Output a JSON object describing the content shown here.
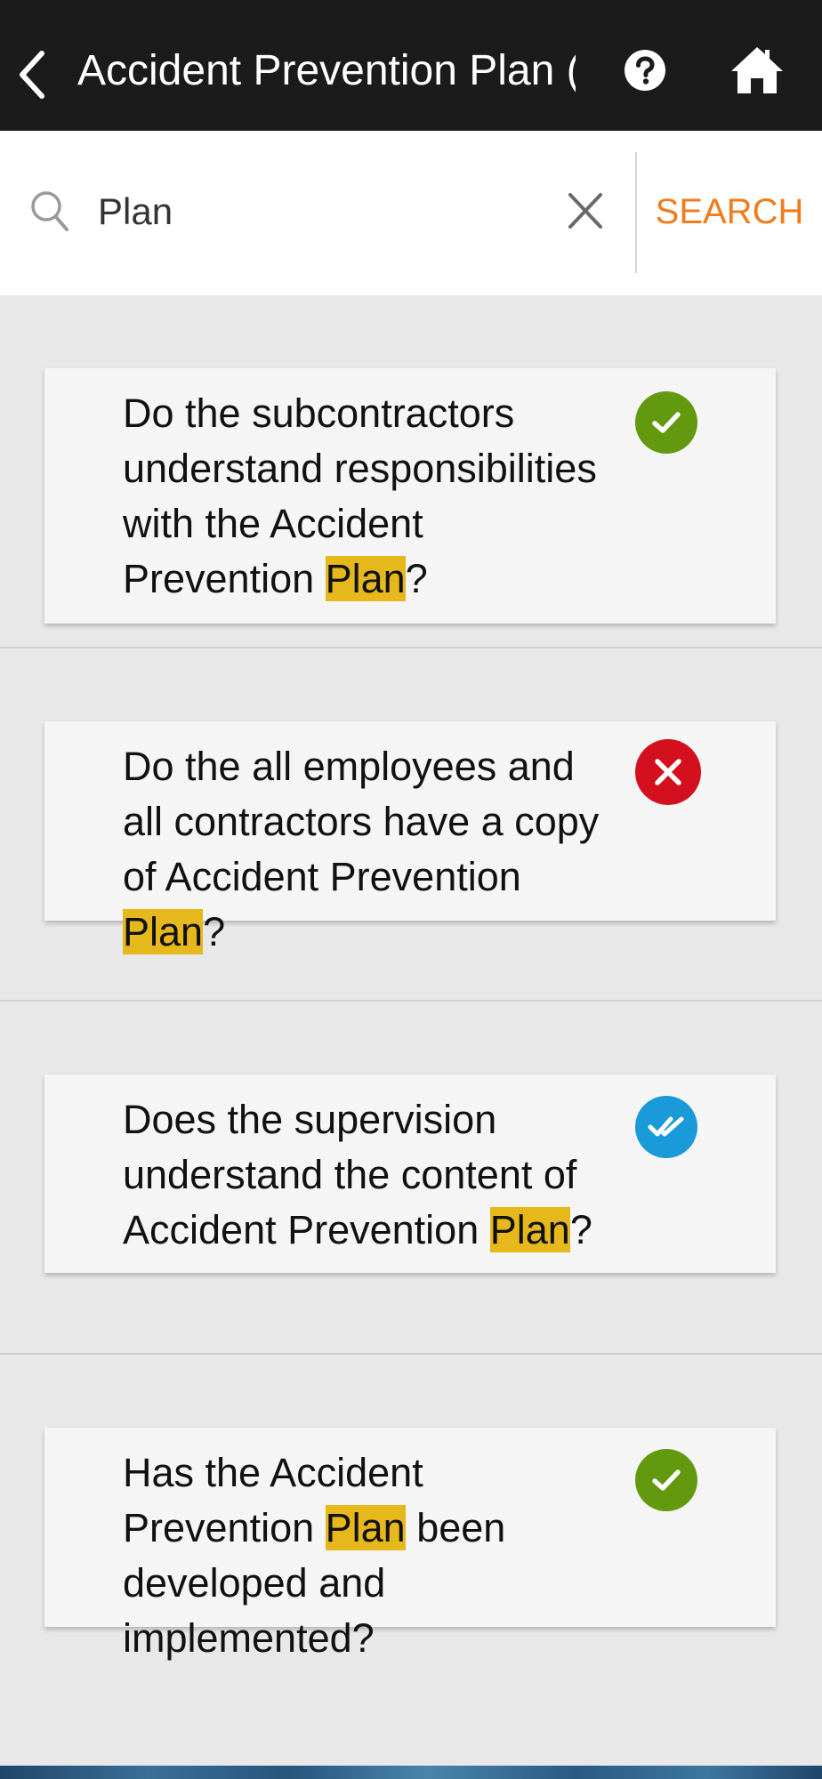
{
  "header": {
    "title": "Accident Prevention Plan (...",
    "back_icon": "chevron-left-icon",
    "help_icon": "help-circle-icon",
    "home_icon": "home-icon"
  },
  "search": {
    "value": "Plan",
    "button_label": "SEARCH",
    "accent_color": "#f07c1c",
    "highlight_color": "#e6b81c"
  },
  "questions": [
    {
      "pre": "Do the subcontractors understand responsibilities with the Accident Prevention ",
      "match": "Plan",
      "post": "?",
      "status": "passed",
      "status_icon": "check-circle-icon",
      "status_color": "#63990f"
    },
    {
      "pre": "Do the all employees and all contractors have a copy of Accident Prevention ",
      "match": "Plan",
      "post": "?",
      "status": "failed",
      "status_icon": "x-circle-icon",
      "status_color": "#d4101f"
    },
    {
      "pre": "Does the supervision understand the content of Accident Prevention ",
      "match": "Plan",
      "post": "?",
      "status": "reviewed",
      "status_icon": "double-check-circle-icon",
      "status_color": "#1a9ad8"
    },
    {
      "pre": "Has the Accident Prevention ",
      "match": "Plan",
      "post": " been developed and implemented?",
      "status": "passed",
      "status_icon": "check-circle-icon",
      "status_color": "#63990f"
    }
  ]
}
